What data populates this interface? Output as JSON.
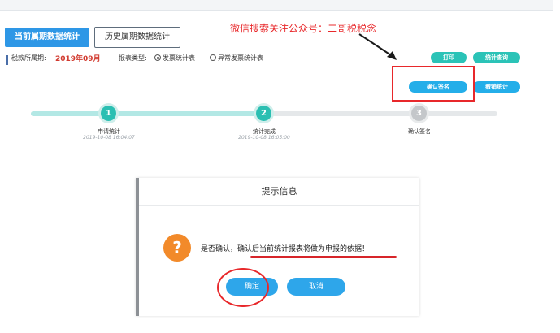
{
  "tabs": [
    {
      "label": "当前属期数据统计",
      "active": true
    },
    {
      "label": "历史属期数据统计",
      "active": false
    }
  ],
  "watermark": "微信搜索关注公众号：二哥税税念",
  "filter": {
    "period_label": "税款所属期:",
    "period_value": "2019年09月",
    "report_type_label": "报表类型:",
    "options": [
      "发票统计表",
      "异常发票统计表"
    ],
    "selected_option": "发票统计表"
  },
  "actions": {
    "print": "打印",
    "stat_query": "统计查询",
    "confirm_sign": "确认签名",
    "cancel_stat": "撤销统计"
  },
  "steps": [
    {
      "num": "1",
      "label": "申请统计",
      "time": "2019-10-08 16:04:07",
      "done": true
    },
    {
      "num": "2",
      "label": "统计完成",
      "time": "2019-10-08 16:05:00",
      "done": true
    },
    {
      "num": "3",
      "label": "确认签名",
      "time": "",
      "done": false
    }
  ],
  "progress": {
    "completed_steps": 2,
    "total_steps": 3
  },
  "dialog": {
    "title": "提示信息",
    "icon": "question-icon",
    "message_prefix": "是否确认，",
    "message_highlight": "确认后当前统计报表将做为申报的依据",
    "message_suffix": "！",
    "ok": "确定",
    "cancel": "取消"
  },
  "colors": {
    "primary": "#2e97e6",
    "teal": "#2bc3b7",
    "annotation_red": "#e8282b",
    "period_red": "#d13a2f",
    "warning_orange": "#f28a2a"
  }
}
